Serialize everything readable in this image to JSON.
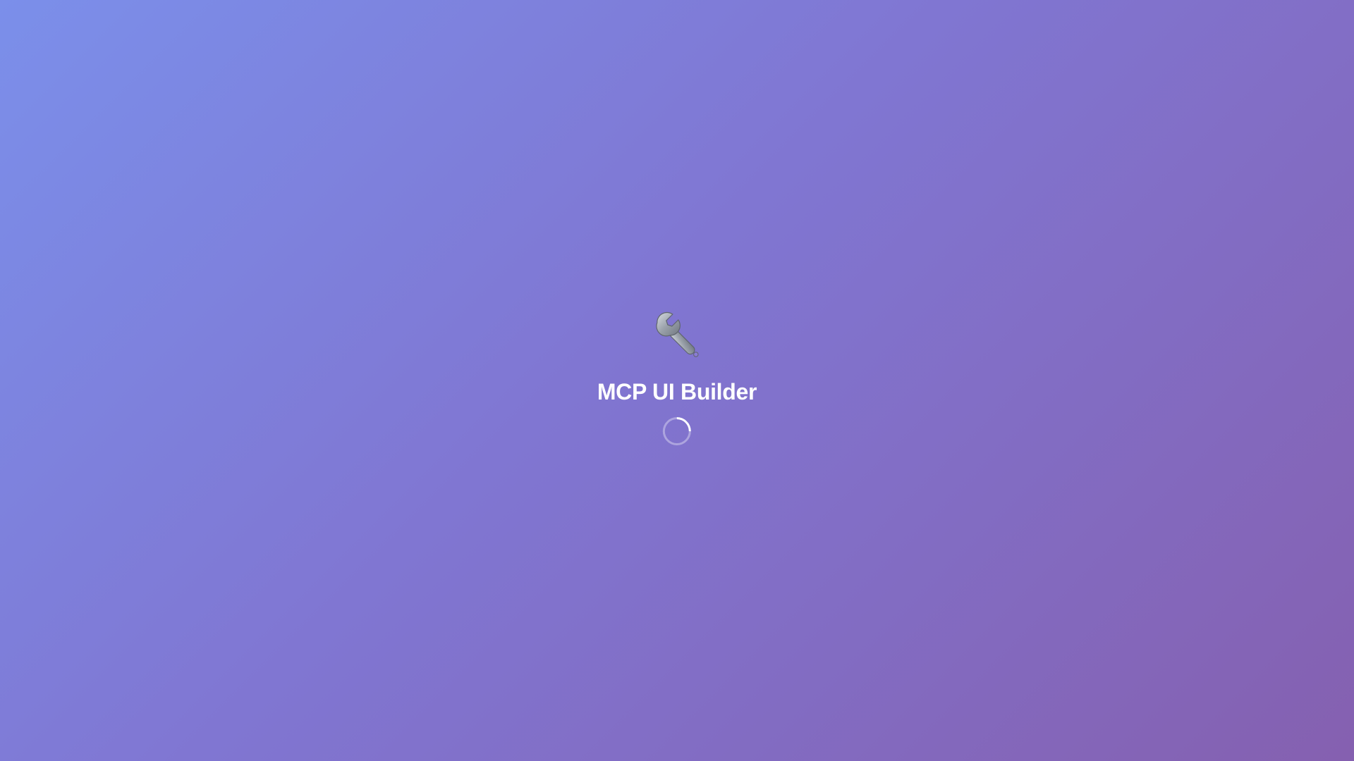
{
  "app": {
    "title": "MCP UI Builder",
    "logo_icon": "wrench-icon"
  },
  "loading": {
    "state": "loading",
    "spinner_icon": "spinner-icon"
  },
  "colors": {
    "background_start": "#7b8fea",
    "background_mid": "#8076d2",
    "background_end": "#8560b0",
    "title": "#ffffff",
    "spinner_track": "rgba(255,255,255,0.35)",
    "spinner_arc": "#ffffff"
  }
}
